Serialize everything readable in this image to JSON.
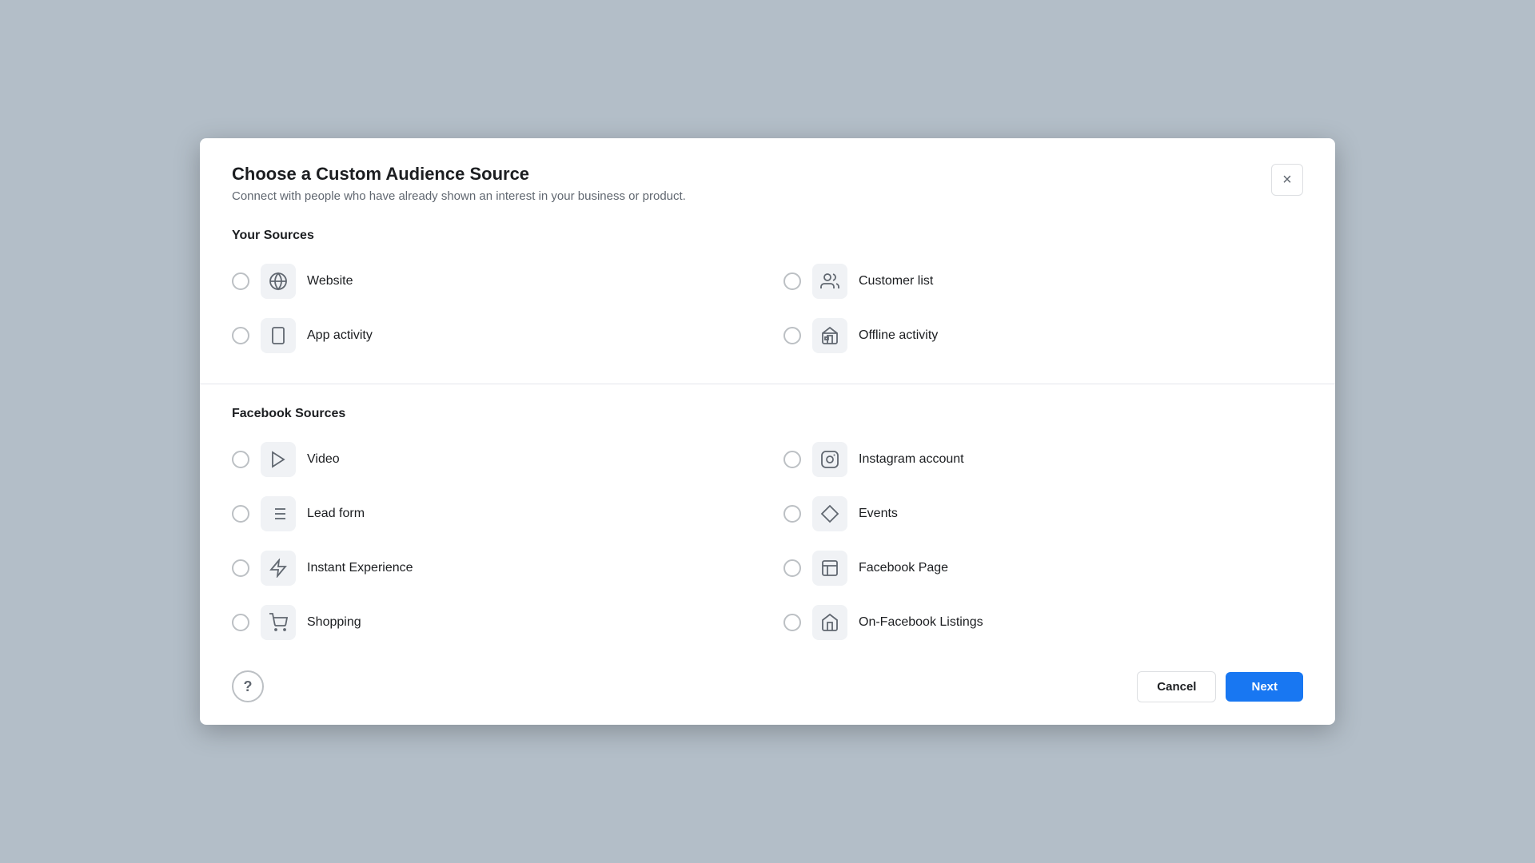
{
  "modal": {
    "title": "Choose a Custom Audience Source",
    "subtitle": "Connect with people who have already shown an interest in your business or product.",
    "close_label": "×",
    "your_sources_title": "Your Sources",
    "facebook_sources_title": "Facebook Sources",
    "your_sources": [
      {
        "id": "website",
        "label": "Website",
        "icon": "globe-icon"
      },
      {
        "id": "customer-list",
        "label": "Customer list",
        "icon": "users-icon"
      },
      {
        "id": "app-activity",
        "label": "App activity",
        "icon": "tablet-icon"
      },
      {
        "id": "offline-activity",
        "label": "Offline activity",
        "icon": "store-icon"
      }
    ],
    "facebook_sources": [
      {
        "id": "video",
        "label": "Video",
        "icon": "play-icon"
      },
      {
        "id": "instagram-account",
        "label": "Instagram account",
        "icon": "instagram-icon"
      },
      {
        "id": "lead-form",
        "label": "Lead form",
        "icon": "list-icon"
      },
      {
        "id": "events",
        "label": "Events",
        "icon": "diamond-icon"
      },
      {
        "id": "instant-experience",
        "label": "Instant Experience",
        "icon": "bolt-icon"
      },
      {
        "id": "facebook-page",
        "label": "Facebook Page",
        "icon": "page-icon"
      },
      {
        "id": "shopping",
        "label": "Shopping",
        "icon": "cart-icon"
      },
      {
        "id": "on-facebook-listings",
        "label": "On-Facebook Listings",
        "icon": "listings-icon"
      }
    ],
    "footer": {
      "help_label": "?",
      "cancel_label": "Cancel",
      "next_label": "Next"
    }
  }
}
